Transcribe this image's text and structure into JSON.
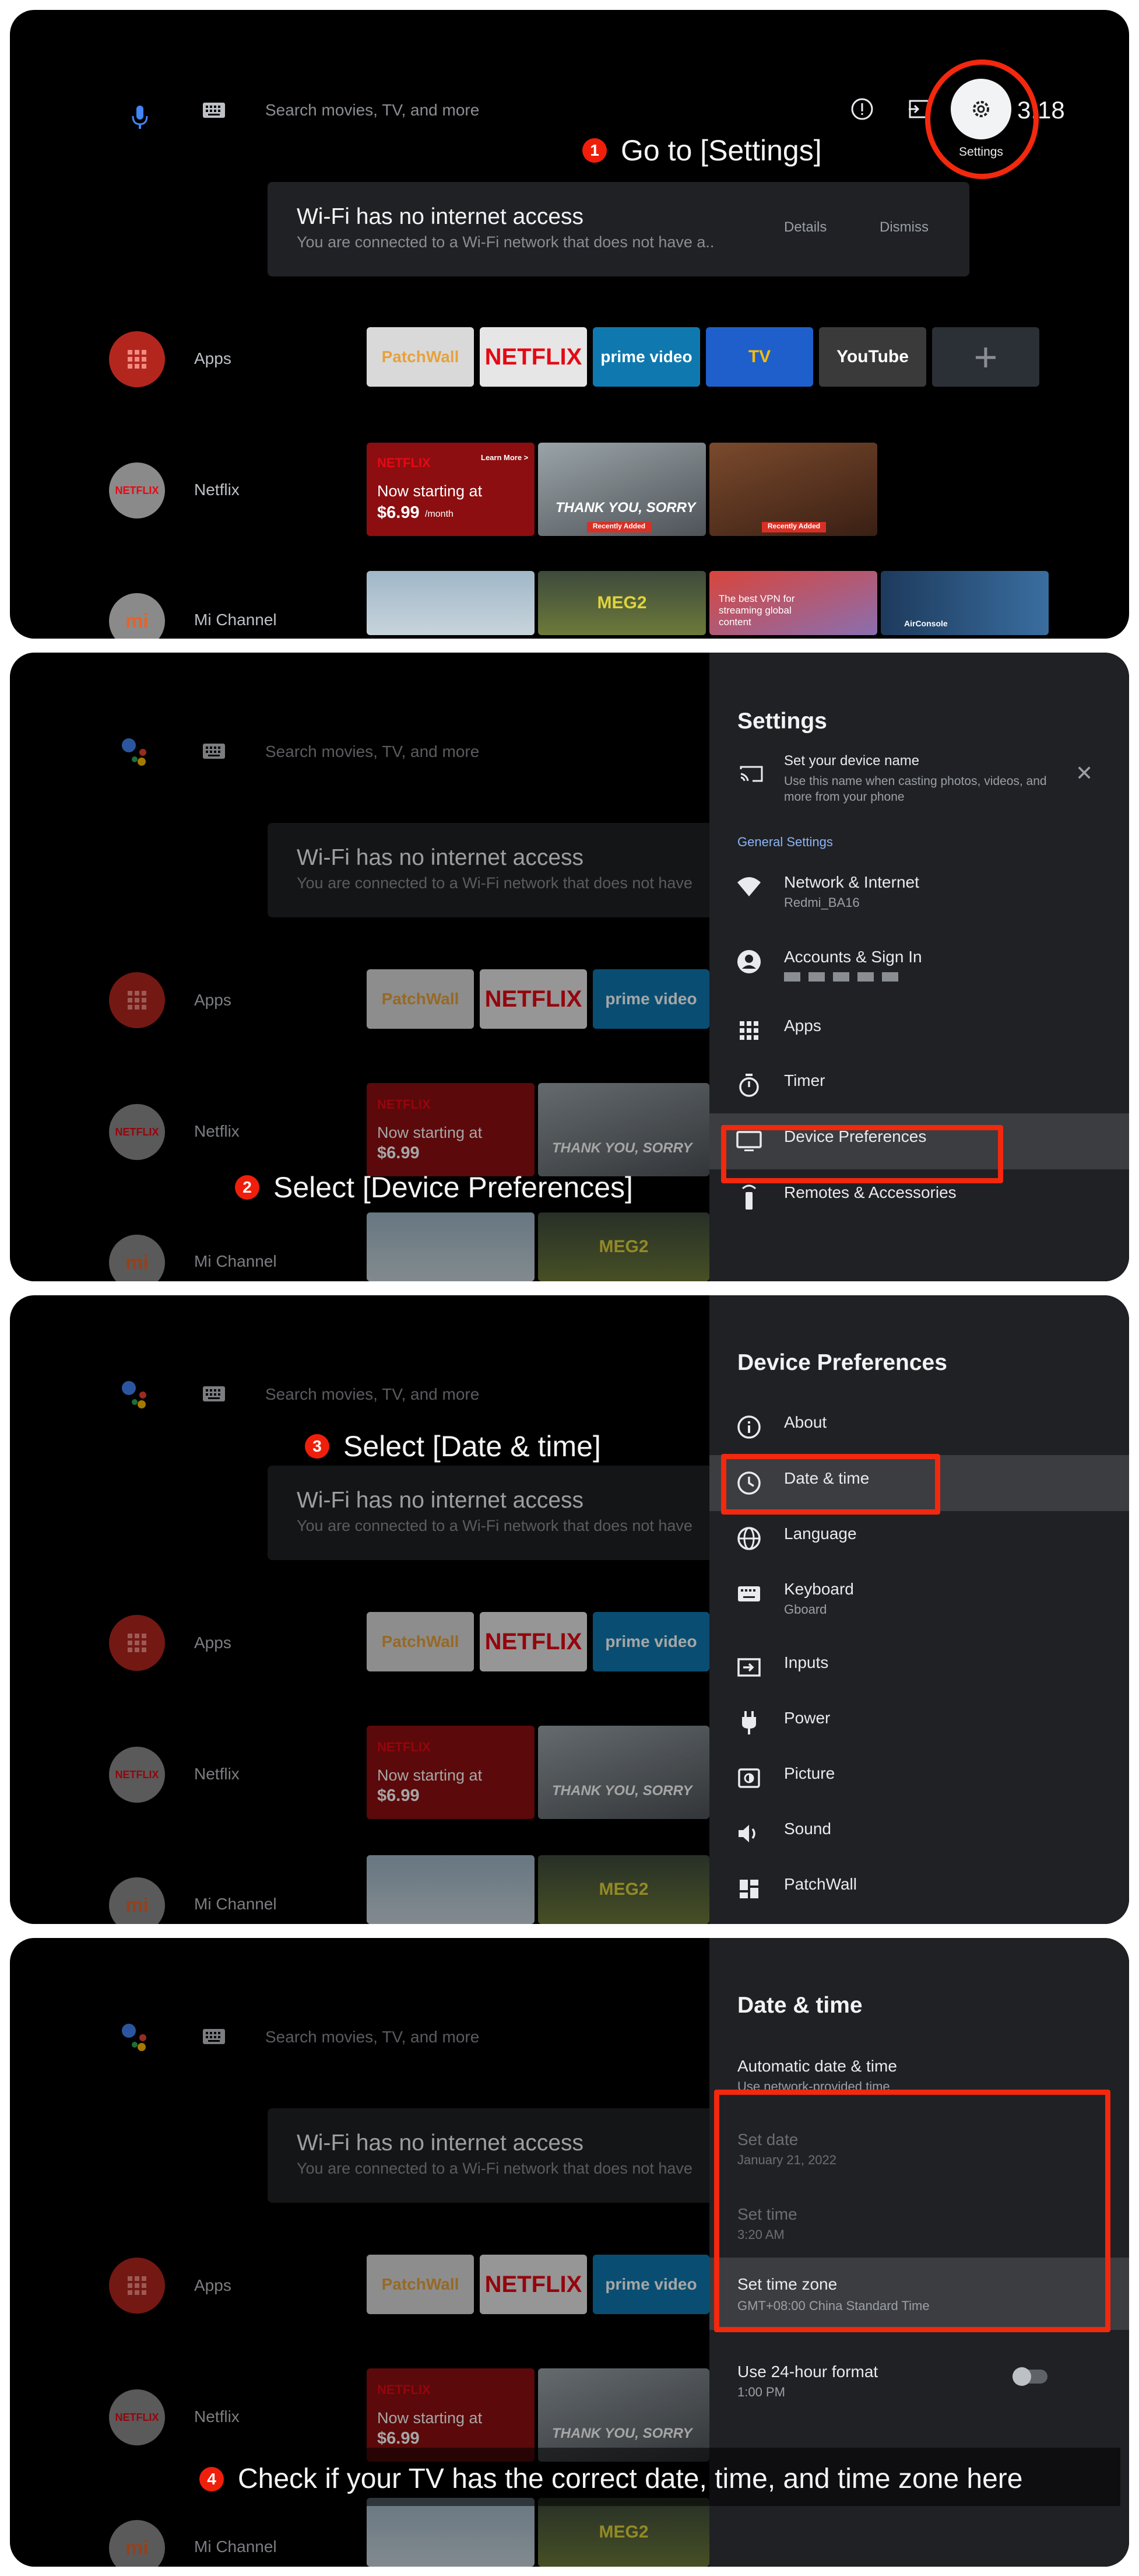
{
  "common": {
    "search_placeholder": "Search movies, TV, and more",
    "banner_title": "Wi-Fi has no internet access",
    "banner_sub": "You are connected to a Wi-Fi network that does not have a..",
    "banner_sub_cut": "You are connected to a Wi-Fi network that does not have",
    "details": "Details",
    "dismiss": "Dismiss",
    "rows": [
      {
        "label": "Apps",
        "icon": "apps-grid-icon"
      },
      {
        "label": "Netflix",
        "icon": "netflix-icon"
      },
      {
        "label": "Mi Channel",
        "icon": "mi-icon"
      }
    ],
    "app_tiles": [
      "PatchWall",
      "NETFLIX",
      "prime video",
      "TV",
      "YouTube",
      "+"
    ],
    "netflix_promo": {
      "brand": "NETFLIX",
      "learn": "Learn More >",
      "line1": "Now starting at",
      "price": "$6.99",
      "per": "/month"
    },
    "tile_tags": [
      "Recently Added",
      "Recently Added"
    ],
    "tile_titles": [
      "THANK YOU, SORRY",
      "MEG2",
      "The best VPN for streaming global content",
      "AirConsole"
    ]
  },
  "panel1": {
    "time": "3:18",
    "settings_label": "Settings",
    "step_num": "1",
    "step_text": "Go to [Settings]"
  },
  "panel2": {
    "side_title": "Settings",
    "cast_title": "Set your device name",
    "cast_sub": "Use this name when casting photos, videos, and more from your phone",
    "section": "General Settings",
    "items": [
      {
        "label": "Network & Internet",
        "sub": "Redmi_BA16",
        "icon": "wifi-icon"
      },
      {
        "label": "Accounts & Sign In",
        "sub": "",
        "icon": "account-icon"
      },
      {
        "label": "Apps",
        "sub": "",
        "icon": "apps-icon"
      },
      {
        "label": "Timer",
        "sub": "",
        "icon": "timer-icon"
      },
      {
        "label": "Device Preferences",
        "sub": "",
        "icon": "tv-icon"
      },
      {
        "label": "Remotes & Accessories",
        "sub": "",
        "icon": "remote-icon"
      }
    ],
    "step_num": "2",
    "step_text": "Select [Device Preferences]"
  },
  "panel3": {
    "side_title": "Device Preferences",
    "items": [
      {
        "label": "About",
        "sub": "",
        "icon": "info-icon"
      },
      {
        "label": "Date & time",
        "sub": "",
        "icon": "clock-icon"
      },
      {
        "label": "Language",
        "sub": "",
        "icon": "globe-icon"
      },
      {
        "label": "Keyboard",
        "sub": "Gboard",
        "icon": "keyboard-icon"
      },
      {
        "label": "Inputs",
        "sub": "",
        "icon": "input-icon"
      },
      {
        "label": "Power",
        "sub": "",
        "icon": "power-plug-icon"
      },
      {
        "label": "Picture",
        "sub": "",
        "icon": "picture-icon"
      },
      {
        "label": "Sound",
        "sub": "",
        "icon": "speaker-icon"
      },
      {
        "label": "PatchWall",
        "sub": "",
        "icon": "patchwall-icon"
      }
    ],
    "step_num": "3",
    "step_text": "Select [Date & time]"
  },
  "panel4": {
    "side_title": "Date & time",
    "items": [
      {
        "label": "Automatic date & time",
        "sub": "Use network-provided time"
      },
      {
        "label": "Set date",
        "sub": "January 21, 2022"
      },
      {
        "label": "Set time",
        "sub": "3:20 AM"
      },
      {
        "label": "Set time zone",
        "sub": "GMT+08:00 China Standard Time"
      },
      {
        "label": "Use 24-hour format",
        "sub": "1:00 PM"
      }
    ],
    "step_num": "4",
    "step_text": "Check if your TV has the correct date, time, and time zone here"
  }
}
